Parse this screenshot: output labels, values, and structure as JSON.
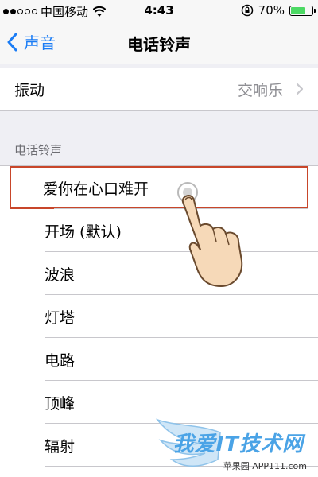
{
  "status_bar": {
    "carrier": "中国移动",
    "time": "4:43",
    "battery": "70%",
    "battery_level": 0.7
  },
  "nav": {
    "back_label": "声音",
    "title": "电话铃声"
  },
  "vibration": {
    "label": "振动",
    "value": "交响乐"
  },
  "section_header": "电话铃声",
  "ringtones": [
    {
      "label": "爱你在心口难开"
    },
    {
      "label": "开场 (默认)"
    },
    {
      "label": "波浪"
    },
    {
      "label": "灯塔"
    },
    {
      "label": "电路"
    },
    {
      "label": "顶峰"
    },
    {
      "label": "辐射"
    }
  ],
  "watermark": {
    "main": "我爱IT技术网",
    "sub": "苹果园 APP111.com"
  },
  "colors": {
    "accent": "#1a7cf5",
    "highlight_border": "#c8462a",
    "battery_fill": "#4cd964"
  }
}
